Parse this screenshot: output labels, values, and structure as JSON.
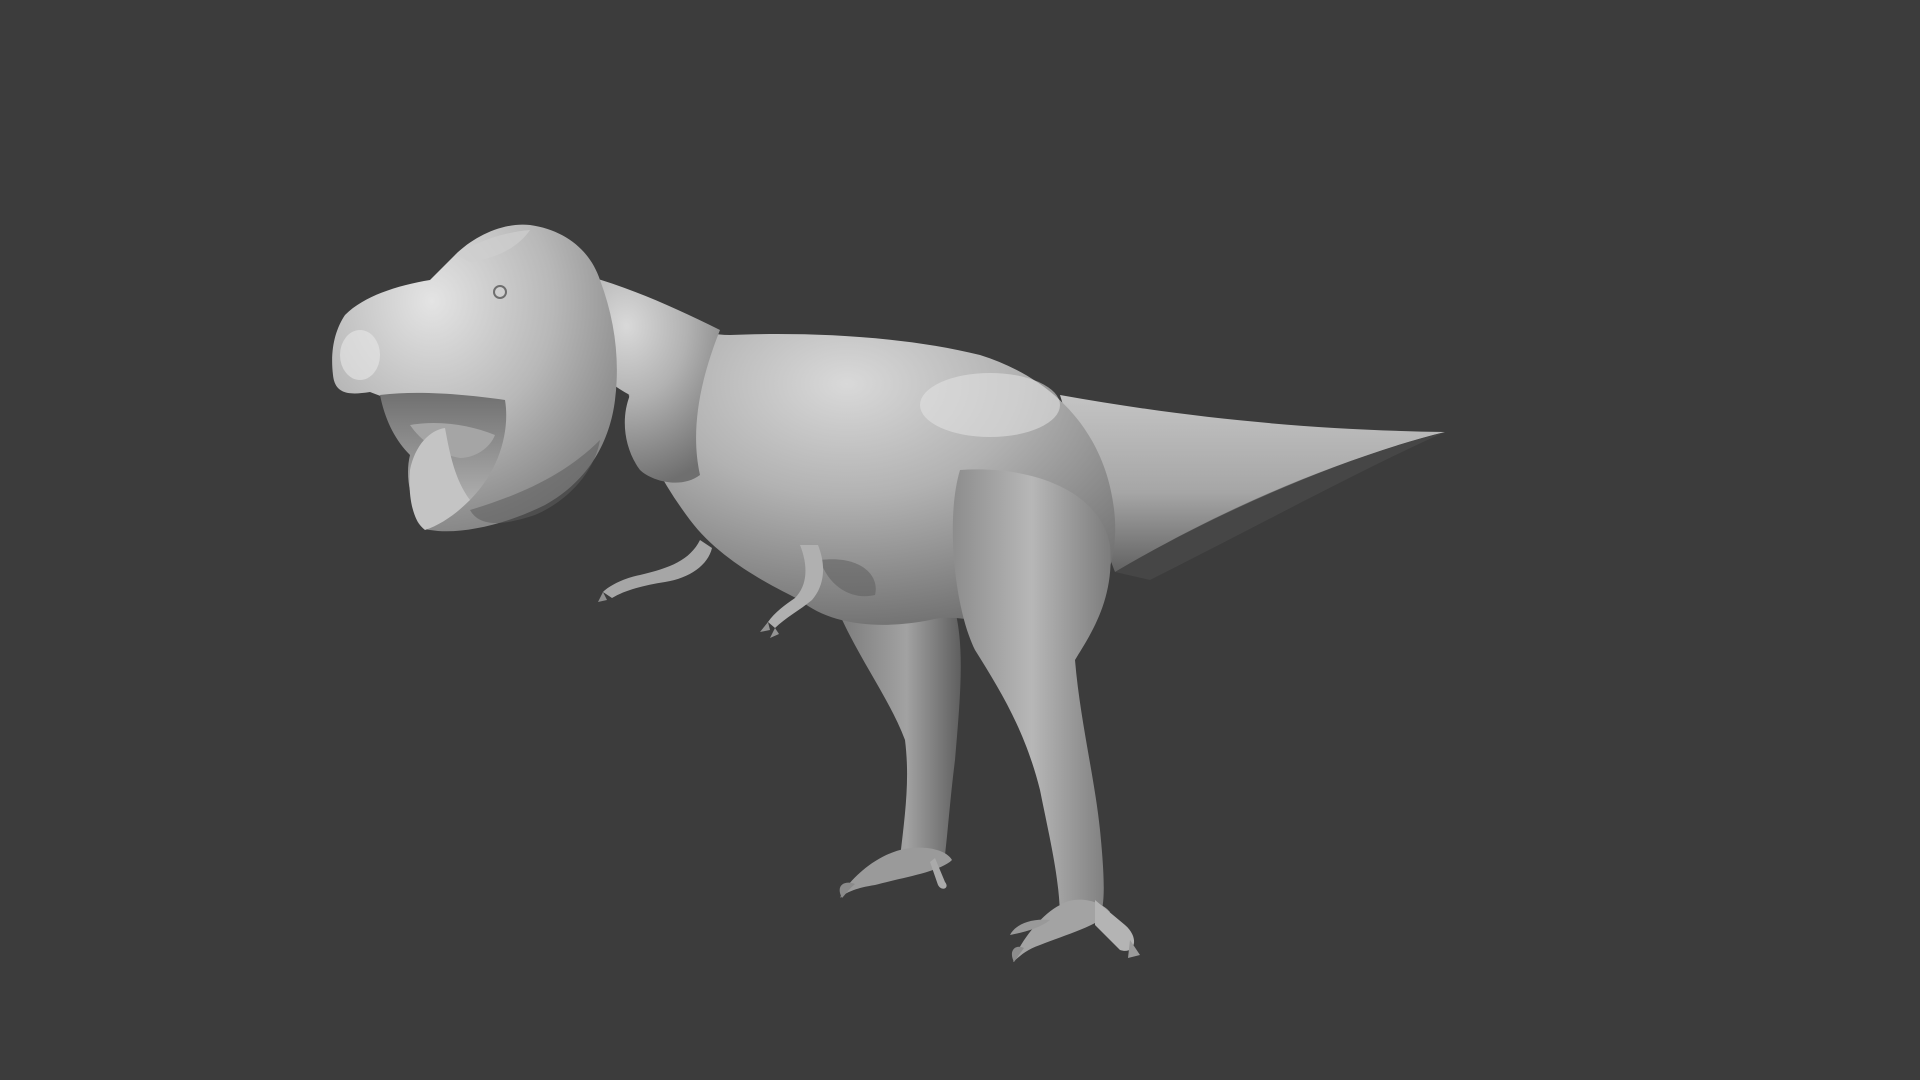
{
  "scene": {
    "subject": "t-rex-model",
    "background_color": "#3c3c3c",
    "material_color": "#a8a8a8",
    "shadow_color": "#5c5c5c",
    "highlight_color": "#dcdcdc",
    "icons": {
      "model": "dinosaur-model-icon"
    }
  }
}
